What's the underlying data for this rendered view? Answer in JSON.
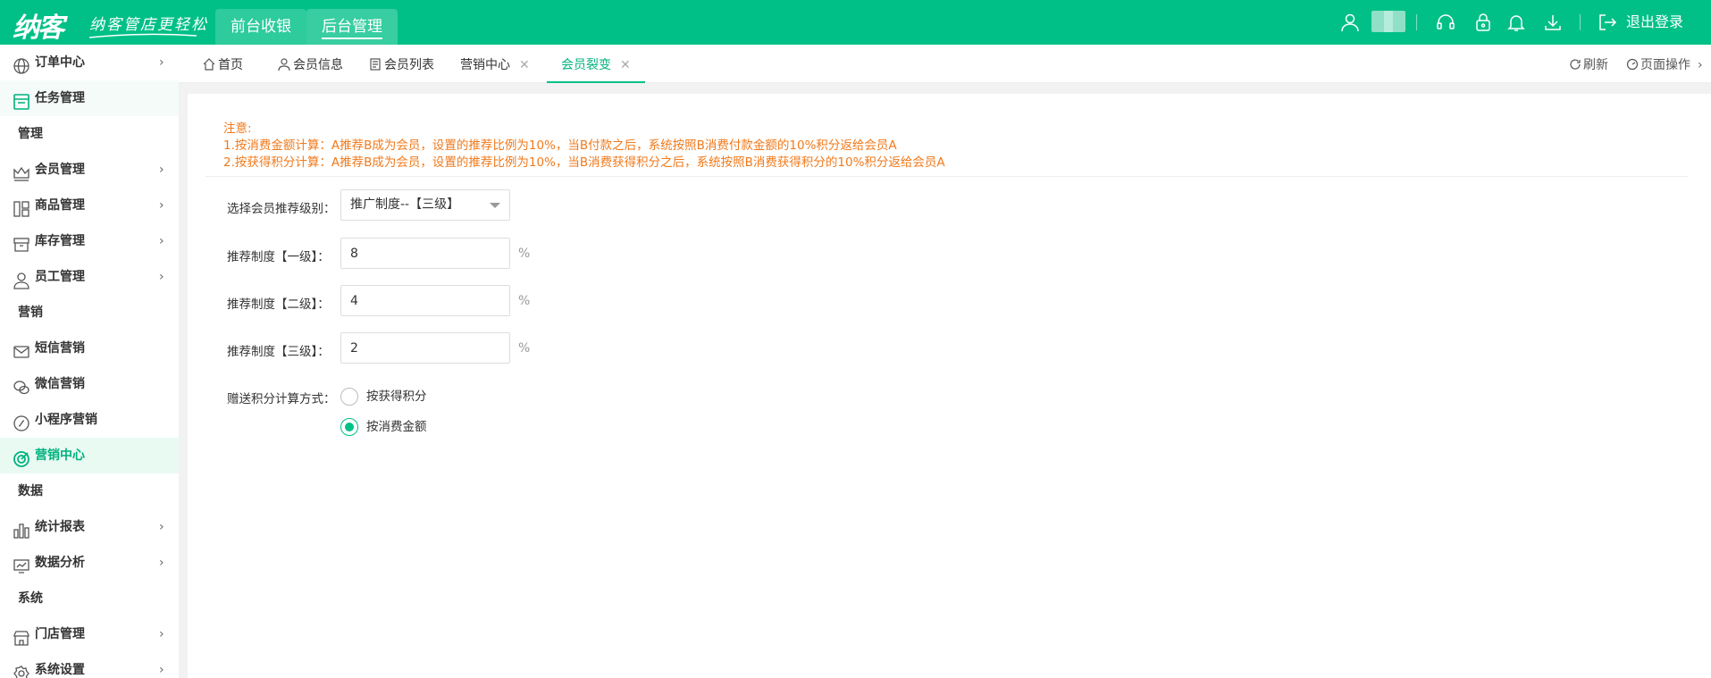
{
  "brand": {
    "logo": "纳客",
    "slogan": "纳客管店更轻松"
  },
  "topnav": {
    "front_label": "前台收银",
    "back_label": "后台管理"
  },
  "topbar": {
    "logout_label": "退出登录",
    "icons": [
      "user-icon",
      "headset-icon",
      "lock-icon",
      "bell-icon",
      "download-icon",
      "logout-icon"
    ]
  },
  "sidebar": {
    "items": [
      {
        "label": "订单中心",
        "icon": "globe-icon",
        "chevron": true
      },
      {
        "label": "任务管理",
        "icon": "task-icon",
        "chevron": false
      },
      {
        "label": "会员管理",
        "icon": "crown-icon",
        "chevron": true
      },
      {
        "label": "商品管理",
        "icon": "goods-icon",
        "chevron": true
      },
      {
        "label": "库存管理",
        "icon": "box-icon",
        "chevron": true
      },
      {
        "label": "员工管理",
        "icon": "person-icon",
        "chevron": true
      },
      {
        "label": "短信营销",
        "icon": "mail-icon",
        "chevron": false
      },
      {
        "label": "微信营销",
        "icon": "wechat-icon",
        "chevron": false
      },
      {
        "label": "小程序营销",
        "icon": "mini-program-icon",
        "chevron": false
      },
      {
        "label": "营销中心",
        "icon": "target-icon",
        "chevron": false,
        "active": true
      },
      {
        "label": "统计报表",
        "icon": "bar-chart-icon",
        "chevron": true
      },
      {
        "label": "数据分析",
        "icon": "monitor-chart-icon",
        "chevron": true
      },
      {
        "label": "门店管理",
        "icon": "store-icon",
        "chevron": true
      },
      {
        "label": "系统设置",
        "icon": "gear-icon",
        "chevron": true
      }
    ],
    "groups": [
      "管理",
      "营销",
      "数据",
      "系统"
    ]
  },
  "tabs": [
    {
      "label": "首页",
      "icon": "home-icon",
      "closable": false
    },
    {
      "label": "会员信息",
      "icon": "member-icon",
      "closable": false
    },
    {
      "label": "会员列表",
      "icon": "list-icon",
      "closable": false
    },
    {
      "label": "营销中心",
      "closable": true
    },
    {
      "label": "会员裂变",
      "closable": true,
      "active": true
    }
  ],
  "tab_actions": {
    "refresh_label": "刷新",
    "page_ops_label": "页面操作"
  },
  "notice": {
    "title": "注意:",
    "line1": "1.按消费金额计算：A推荐B成为会员，设置的推荐比例为10%，当B付款之后，系统按照B消费付款金额的10%积分返给会员A",
    "line2": "2.按获得积分计算：A推荐B成为会员，设置的推荐比例为10%，当B消费获得积分之后，系统按照B消费获得积分的10%积分返给会员A"
  },
  "form": {
    "level_label": "选择会员推荐级别：",
    "level_value": "推广制度--【三级】",
    "level1_label": "推荐制度【一级】：",
    "level1_value": "8",
    "level2_label": "推荐制度【二级】：",
    "level2_value": "4",
    "level3_label": "推荐制度【三级】：",
    "level3_value": "2",
    "percent": "%",
    "calc_label": "赠送积分计算方式：",
    "calc_options": [
      "按获得积分",
      "按消费金额"
    ],
    "calc_selected": "按消费金额"
  },
  "colors": {
    "brand_green": "#00c087",
    "active_text": "#00b27e",
    "notice_orange": "#f07a1c"
  }
}
